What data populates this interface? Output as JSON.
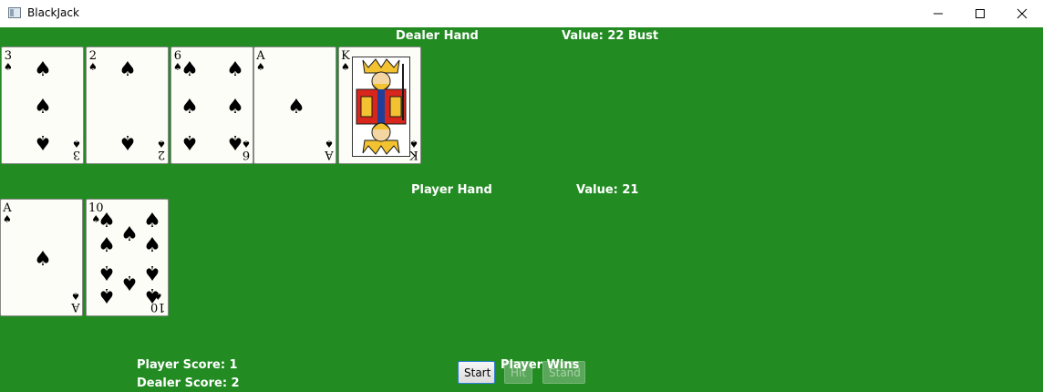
{
  "window": {
    "title": "BlackJack"
  },
  "dealer": {
    "label": "Dealer Hand",
    "value_text": "Value: 22 Bust",
    "cards": [
      {
        "rank": "3",
        "suit": "♠"
      },
      {
        "rank": "2",
        "suit": "♠"
      },
      {
        "rank": "6",
        "suit": "♠"
      },
      {
        "rank": "A",
        "suit": "♠"
      },
      {
        "rank": "K",
        "suit": "♠"
      }
    ]
  },
  "player": {
    "label": "Player Hand",
    "value_text": "Value: 21",
    "cards": [
      {
        "rank": "A",
        "suit": "♠"
      },
      {
        "rank": "10",
        "suit": "♠"
      }
    ]
  },
  "controls": {
    "start_label": "Start",
    "hit_label": "Hit",
    "stand_label": "Stand",
    "hit_enabled": false,
    "stand_enabled": false
  },
  "scores": {
    "player_text": "Player Score: 1",
    "dealer_text": "Dealer Score: 2"
  },
  "result_text": "Player Wins",
  "colors": {
    "table": "#228b22",
    "label": "#ffffff"
  }
}
